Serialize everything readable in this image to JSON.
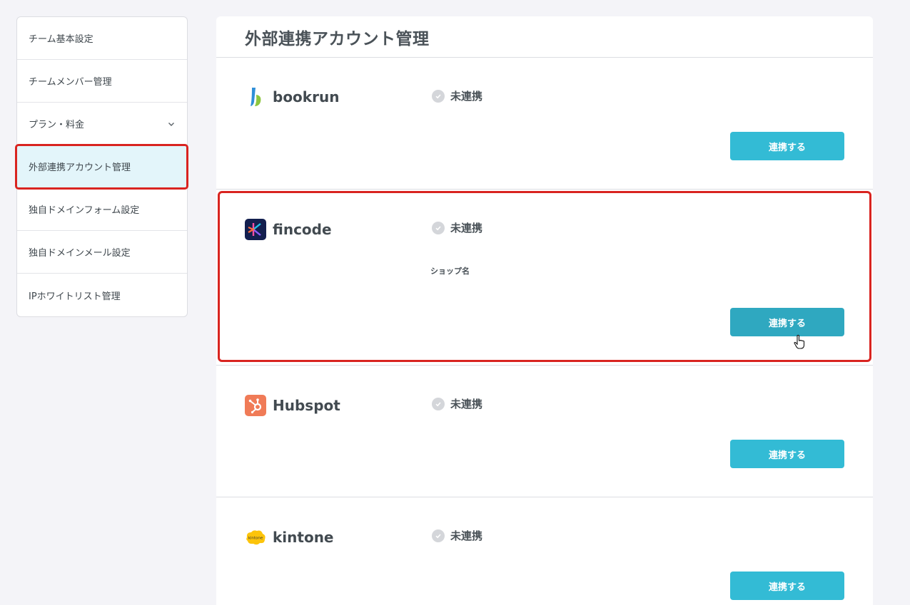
{
  "sidebar": {
    "items": [
      {
        "label": "チーム基本設定"
      },
      {
        "label": "チームメンバー管理"
      },
      {
        "label": "プラン・料金"
      },
      {
        "label": "外部連携アカウント管理"
      },
      {
        "label": "独自ドメインフォーム設定"
      },
      {
        "label": "独自ドメインメール設定"
      },
      {
        "label": "IPホワイトリスト管理"
      }
    ]
  },
  "main": {
    "title": "外部連携アカウント管理",
    "services": [
      {
        "name": "bookrun",
        "status": "未連携",
        "button": "連携する",
        "icon": "bookrun-logo"
      },
      {
        "name": "fincode",
        "status": "未連携",
        "button": "連携する",
        "field_label": "ショップ名",
        "icon": "fincode-logo"
      },
      {
        "name": "Hubspot",
        "status": "未連携",
        "button": "連携する",
        "icon": "hubspot-logo"
      },
      {
        "name": "kintone",
        "status": "未連携",
        "button": "連携する",
        "icon": "kintone-logo",
        "logo_text": "kintone"
      }
    ]
  },
  "colors": {
    "accent": "#33bbd5",
    "highlight": "#d92420",
    "active_bg": "#e3f5fa"
  }
}
